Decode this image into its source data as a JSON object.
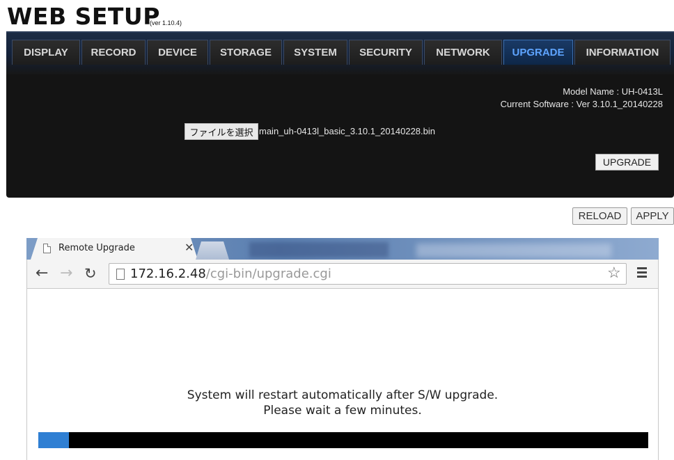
{
  "websetup": {
    "title": "WEB SETUP",
    "version": "(ver 1.10.4)",
    "tabs": [
      "DISPLAY",
      "RECORD",
      "DEVICE",
      "STORAGE",
      "SYSTEM",
      "SECURITY",
      "NETWORK",
      "UPGRADE",
      "INFORMATION"
    ],
    "active_tab": "UPGRADE",
    "model_name": "Model Name : UH-0413L",
    "current_software": "Current Software : Ver 3.10.1_20140228",
    "file_button": "ファイルを選択",
    "file_name": "main_uh-0413l_basic_3.10.1_20140228.bin",
    "upgrade_button": "UPGRADE",
    "reload_button": "RELOAD",
    "apply_button": "APPLY"
  },
  "browser": {
    "tab_title": "Remote Upgrade",
    "url_host": "172.16.2.48",
    "url_path": "/cgi-bin/upgrade.cgi",
    "message_line1": "System will restart automatically after S/W upgrade.",
    "message_line2": "Please wait a few minutes.",
    "progress_fraction": 0.05,
    "progress_color": "#2f7fd3"
  },
  "colors": {
    "panel_bg": "#141414",
    "active_tab_text": "#5ea4ff"
  }
}
